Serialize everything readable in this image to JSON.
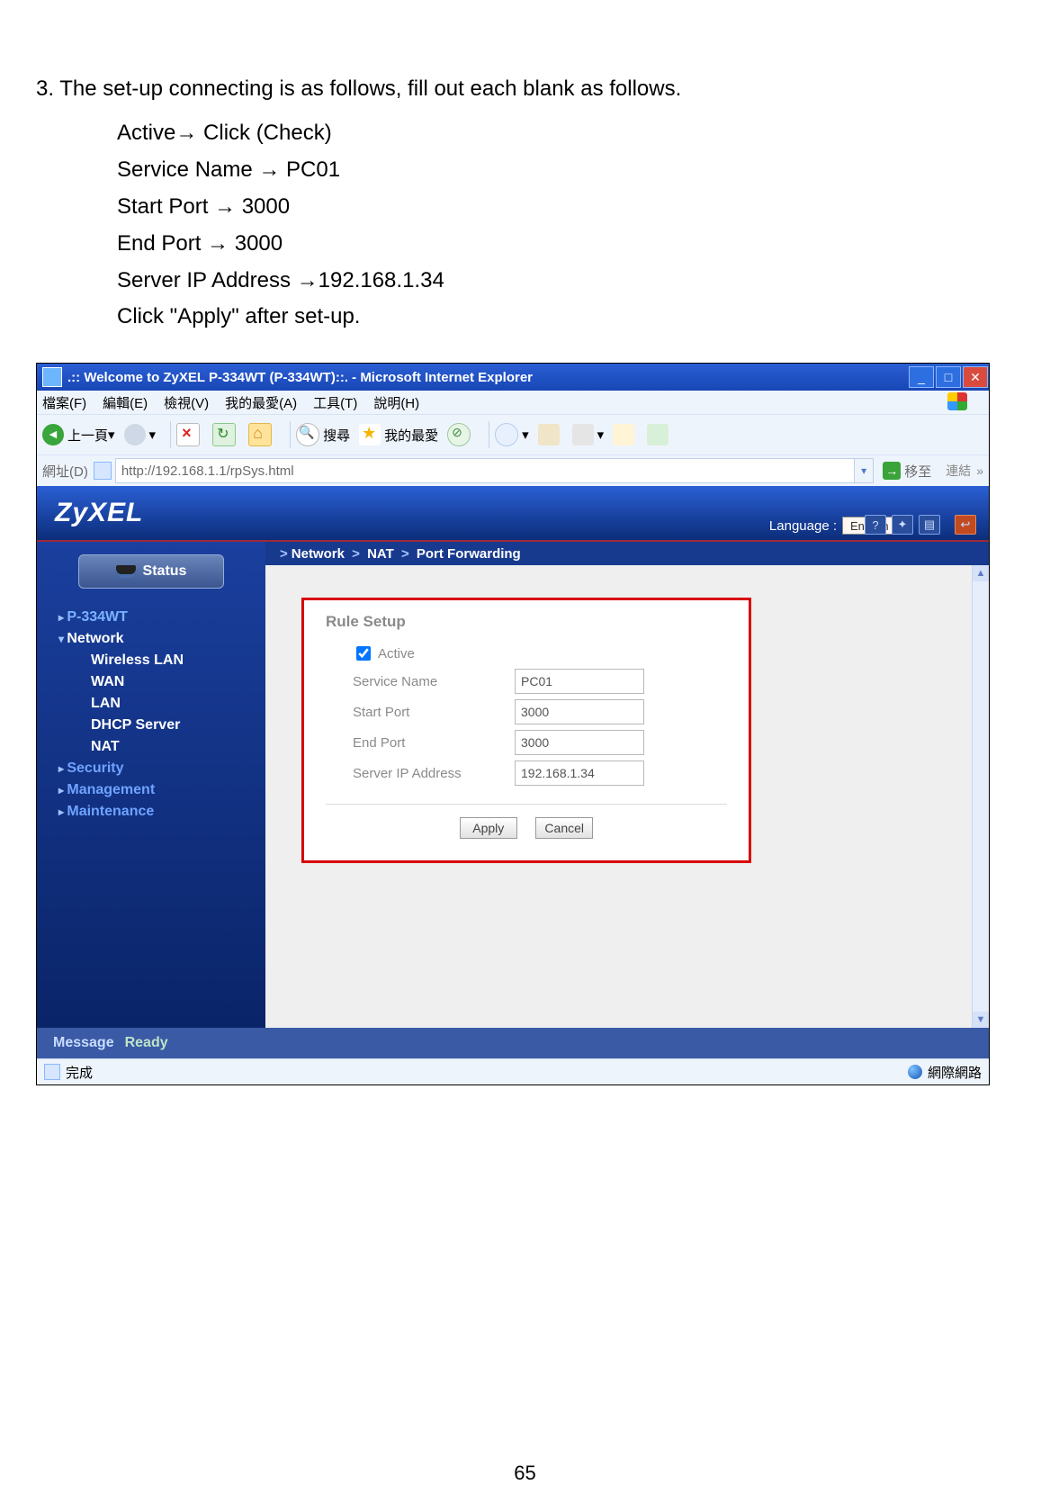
{
  "doc": {
    "step": "3. The set-up connecting is as follows, fill out each blank as follows.",
    "lines": {
      "active": "Active→ Click (Check)",
      "service": "Service Name → PC01",
      "start": "Start Port → 3000",
      "end": "End Port → 3000",
      "ip": "Server IP Address →192.168.1.34",
      "apply": "Click \"Apply\" after set-up."
    },
    "page_number": "65"
  },
  "ie": {
    "title": ".:: Welcome to ZyXEL P-334WT (P-334WT)::. - Microsoft Internet Explorer",
    "menu": {
      "file": "檔案(F)",
      "edit": "編輯(E)",
      "view": "檢視(V)",
      "fav": "我的最愛(A)",
      "tools": "工具(T)",
      "help": "說明(H)"
    },
    "toolbar": {
      "back": "上一頁",
      "search": "搜尋",
      "fav": "我的最愛"
    },
    "address_label": "網址(D)",
    "address": "http://192.168.1.1/rpSys.html",
    "go": "移至",
    "links": "連結",
    "status_done": "完成",
    "status_zone": "網際網路"
  },
  "zy": {
    "logo": "ZyXEL",
    "language_label": "Language :",
    "language_value": "English",
    "breadcrumb": {
      "p1": "Network",
      "p2": "NAT",
      "p3": "Port Forwarding"
    },
    "side": {
      "status": "Status",
      "device": "P-334WT",
      "network": "Network",
      "wlan": "Wireless LAN",
      "wan": "WAN",
      "lan": "LAN",
      "dhcp": "DHCP Server",
      "nat": "NAT",
      "security": "Security",
      "management": "Management",
      "maintenance": "Maintenance"
    },
    "panel": {
      "title": "Rule Setup",
      "active_label": "Active",
      "service_label": "Service Name",
      "start_label": "Start Port",
      "end_label": "End Port",
      "ip_label": "Server IP Address",
      "service_value": "PC01",
      "start_value": "3000",
      "end_value": "3000",
      "ip_value": "192.168.1.34",
      "apply": "Apply",
      "cancel": "Cancel"
    },
    "message_label": "Message",
    "message_value": "Ready"
  }
}
